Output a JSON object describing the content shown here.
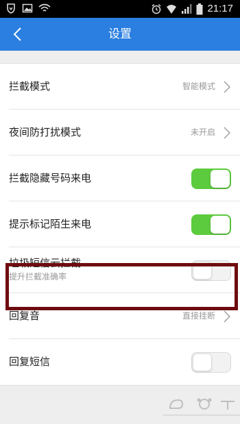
{
  "status_bar": {
    "time": "21:17",
    "icons": [
      "shield-icon",
      "picture-icon",
      "wifi-icon",
      "alarm-icon",
      "wifi-signal-icon",
      "cell-signal-icon",
      "battery-icon"
    ]
  },
  "header": {
    "title": "设置",
    "back_icon": "chevron-left-icon",
    "background": "#2a7fe0"
  },
  "settings": {
    "intercept_mode": {
      "label": "拦截模式",
      "value": "智能模式"
    },
    "night_mode": {
      "label": "夜间防打扰模式",
      "value": "未开启"
    },
    "hidden_number": {
      "label": "拦截隐藏号码来电",
      "on": true
    },
    "mark_stranger": {
      "label": "提示标记陌生来电",
      "on": true
    },
    "spam_sms_cloud": {
      "label": "垃圾短信云拦截",
      "sub": "提升拦截准确率",
      "on": false
    },
    "reply_tone": {
      "label": "回复音",
      "value": "直接挂断"
    },
    "reply_sms": {
      "label": "回复短信",
      "on": false
    }
  },
  "colors": {
    "toggle_on": "#5ccb3d",
    "highlight_border": "#6e0c10"
  }
}
